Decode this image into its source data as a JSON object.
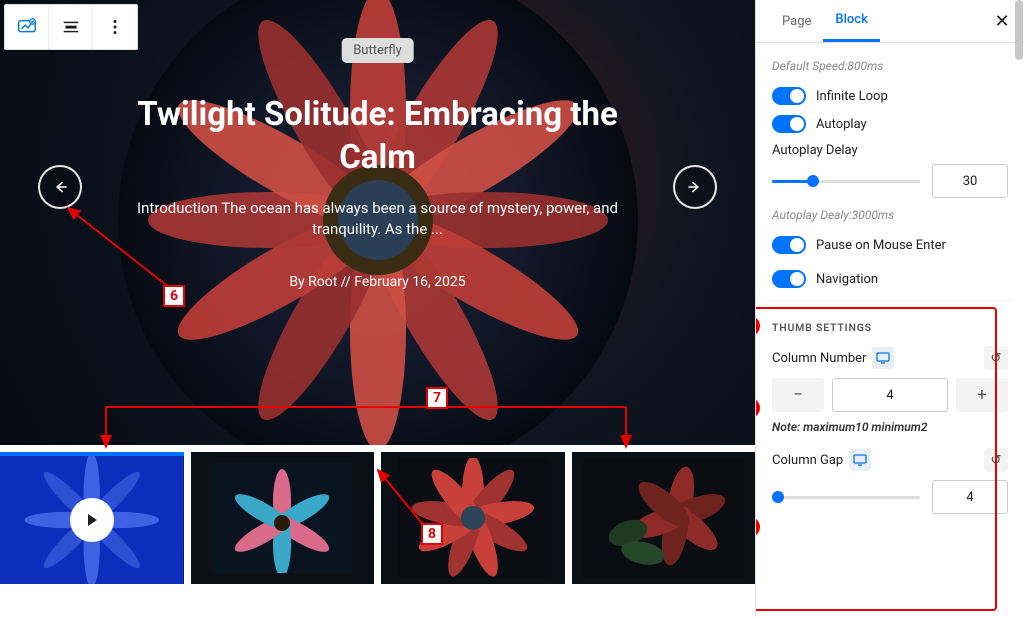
{
  "tabs": {
    "page": "Page",
    "block": "Block"
  },
  "hero": {
    "pill": "Butterfly",
    "title": "Twilight Solitude: Embracing the Calm",
    "caption": "Introduction The ocean has always been a source of mystery, power, and tranquility. As the ...",
    "meta": "By Root  //  February 16, 2025"
  },
  "settings": {
    "default_speed_note": "Default Speed:800ms",
    "infinite_loop": "Infinite Loop",
    "autoplay": "Autoplay",
    "autoplay_delay_label": "Autoplay Delay",
    "autoplay_delay_value": "30",
    "autoplay_delay_note": "Autoplay Dealy:3000ms",
    "pause_on_enter": "Pause on Mouse Enter",
    "navigation": "Navigation",
    "thumb_heading": "THUMB SETTINGS",
    "column_number_label": "Column Number",
    "column_number_value": "4",
    "column_number_note": "Note: maximum10 minimum2",
    "column_gap_label": "Column Gap",
    "column_gap_value": "4"
  },
  "anno": {
    "six": "6",
    "seven": "7",
    "eight": "8"
  }
}
